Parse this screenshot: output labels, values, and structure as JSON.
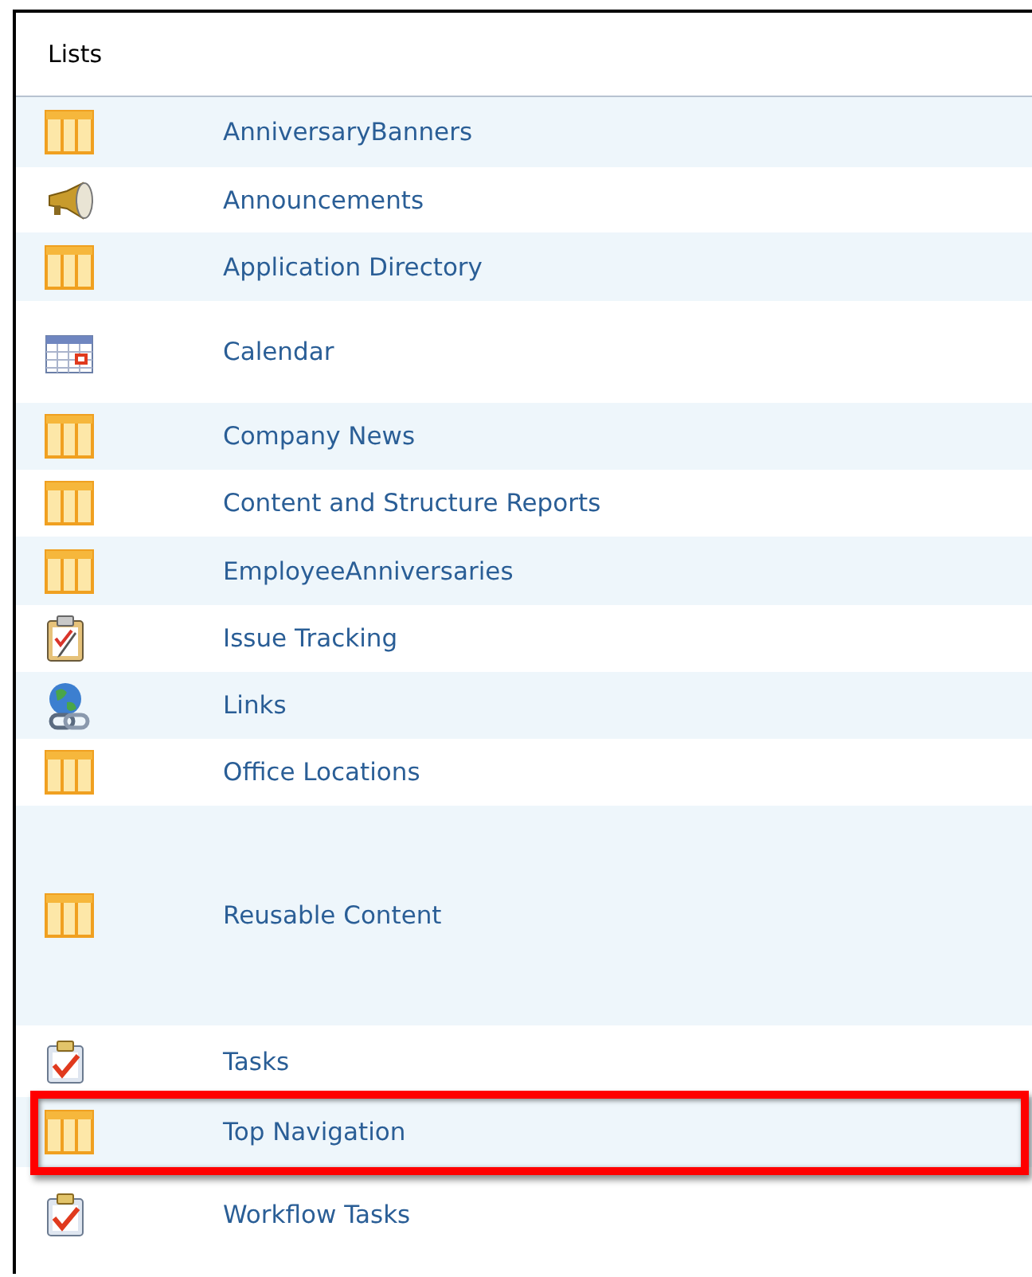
{
  "header": {
    "title": "Lists"
  },
  "rows": [
    {
      "kind": "list",
      "name": "AnniversaryBanners",
      "highlighted": false
    },
    {
      "kind": "announcement",
      "name": "Announcements",
      "highlighted": false
    },
    {
      "kind": "list",
      "name": "Application Directory",
      "highlighted": false
    },
    {
      "kind": "calendar",
      "name": "Calendar",
      "highlighted": false
    },
    {
      "kind": "list",
      "name": "Company News",
      "highlighted": false
    },
    {
      "kind": "list",
      "name": "Content and Structure Reports",
      "highlighted": false
    },
    {
      "kind": "list",
      "name": "EmployeeAnniversaries",
      "highlighted": false
    },
    {
      "kind": "issue",
      "name": "Issue Tracking",
      "highlighted": false
    },
    {
      "kind": "links",
      "name": "Links",
      "highlighted": false
    },
    {
      "kind": "list",
      "name": "Office Locations",
      "highlighted": false
    },
    {
      "kind": "list",
      "name": "Reusable Content",
      "highlighted": false
    },
    {
      "kind": "tasks",
      "name": "Tasks",
      "highlighted": false
    },
    {
      "kind": "list",
      "name": "Top Navigation",
      "highlighted": true
    },
    {
      "kind": "tasks",
      "name": "Workflow Tasks",
      "highlighted": false
    }
  ]
}
